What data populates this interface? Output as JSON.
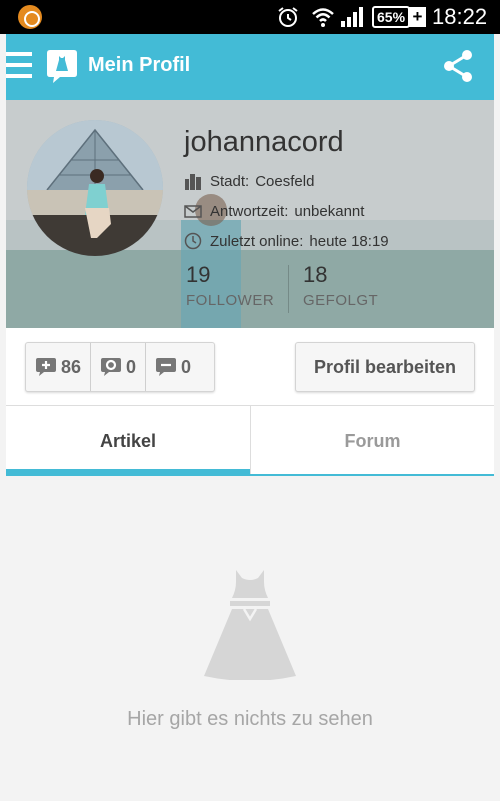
{
  "status_bar": {
    "battery": "65%",
    "time": "18:22"
  },
  "app_bar": {
    "title": "Mein Profil"
  },
  "profile": {
    "username": "johannacord",
    "city_label": "Stadt:",
    "city_value": "Coesfeld",
    "response_label": "Antwortzeit:",
    "response_value": "unbekannt",
    "online_label": "Zuletzt online:",
    "online_value": "heute 18:19",
    "followers_count": "19",
    "followers_label": "FOLLOWER",
    "following_count": "18",
    "following_label": "GEFOLGT"
  },
  "counters": {
    "add": "86",
    "questions": "0",
    "comments": "0"
  },
  "edit_button_label": "Profil bearbeiten",
  "tabs": [
    {
      "label": "Artikel",
      "active": true
    },
    {
      "label": "Forum",
      "active": false
    }
  ],
  "empty_state": {
    "text": "Hier gibt es nichts zu sehen"
  },
  "colors": {
    "accent": "#43bbd6",
    "status_bar": "#000000"
  },
  "icons": [
    "app-notification-icon",
    "alarm-icon",
    "wifi-icon",
    "signal-icon",
    "battery-icon",
    "charging-icon",
    "menu-icon",
    "app-logo-icon",
    "share-icon",
    "city-icon",
    "mail-icon",
    "clock-icon",
    "add-comment-icon",
    "question-icon",
    "comment-icon",
    "dress-icon"
  ]
}
